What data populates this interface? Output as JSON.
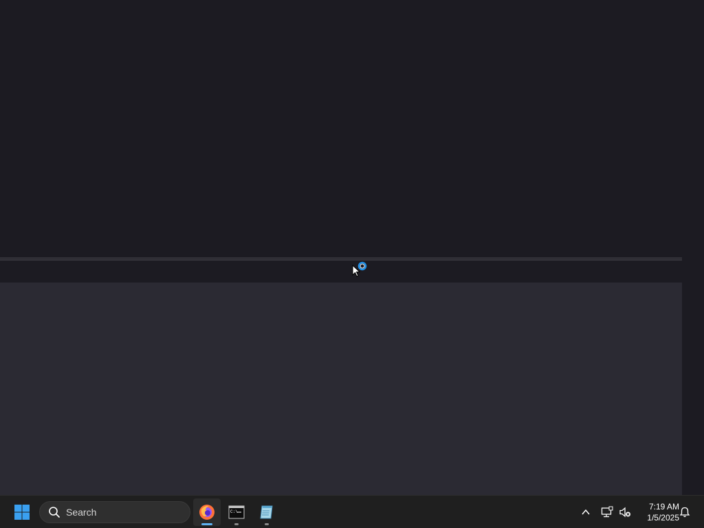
{
  "taskbar": {
    "search_placeholder": "Search",
    "apps": [
      {
        "name": "Firefox",
        "icon": "firefox-icon",
        "active": true
      },
      {
        "name": "Command Prompt",
        "icon": "terminal-icon",
        "active": false
      },
      {
        "name": "Notepad",
        "icon": "notepad-icon",
        "active": false
      }
    ],
    "clock": {
      "time": "7:19 AM",
      "date": "1/5/2025"
    }
  },
  "colors": {
    "accent": "#5fb2f2",
    "desktop": "#1c1b22",
    "content": "#2b2a33",
    "taskbar": "#1f1f1f"
  }
}
